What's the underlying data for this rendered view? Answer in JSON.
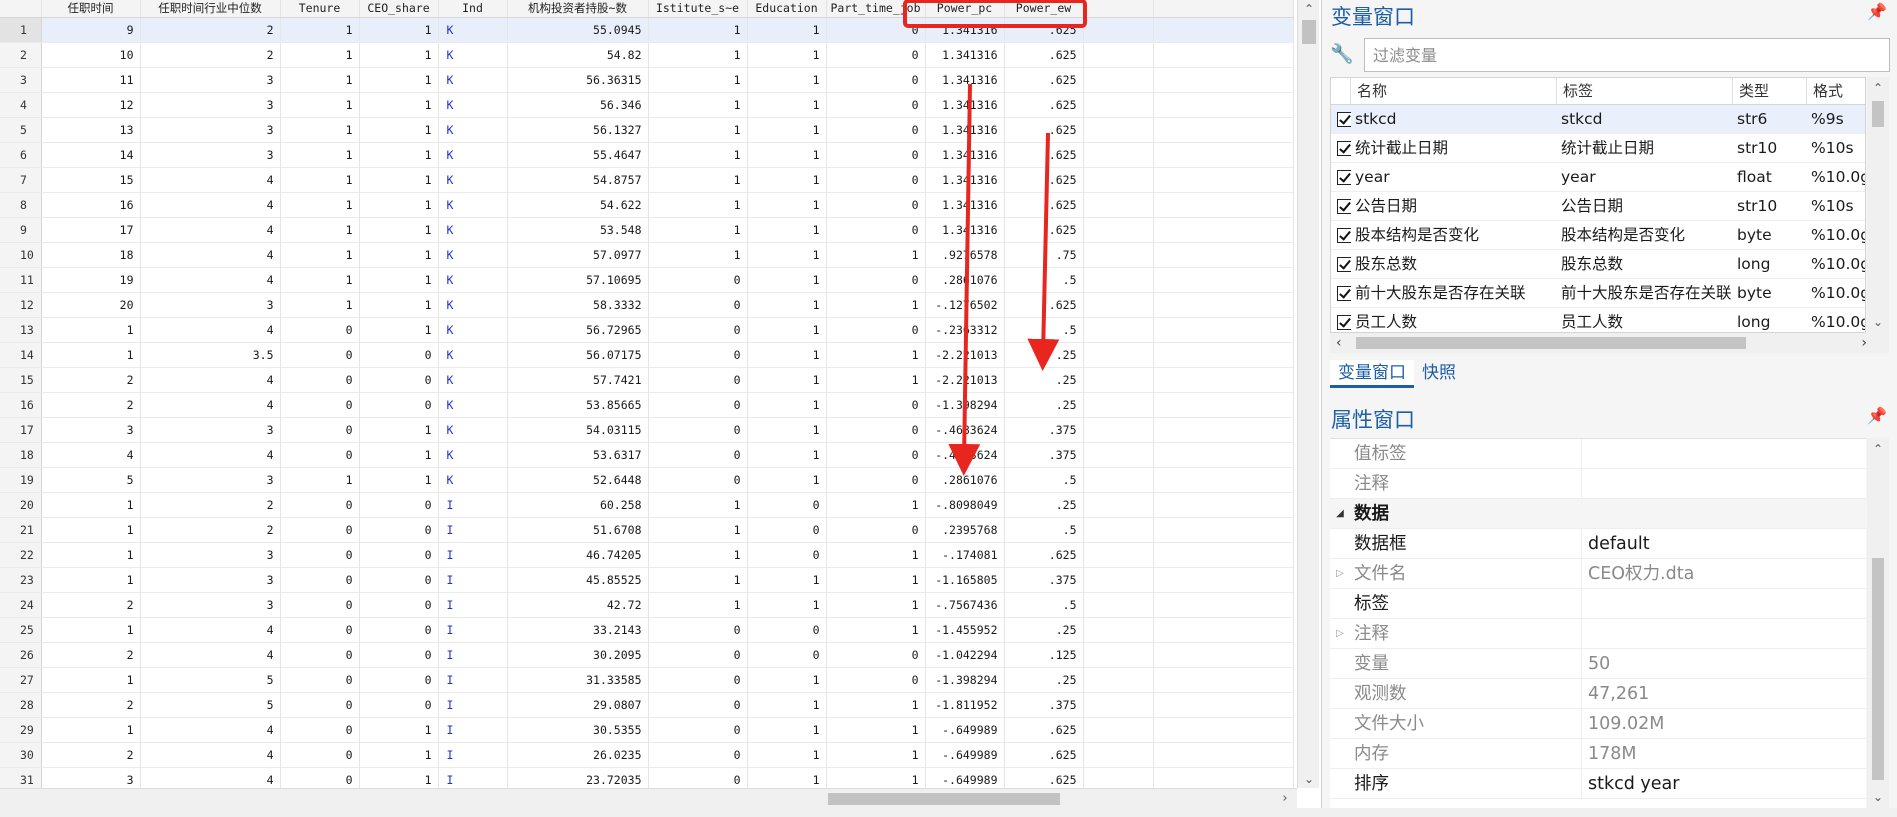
{
  "grid": {
    "columns": [
      "任职时间",
      "任职时间行业中位数",
      "Tenure",
      "CEO_share",
      "Ind",
      "机构投资者持股~数",
      "Istitute_s~e",
      "Education",
      "Part_time_job",
      "Power_pc",
      "Power_ew"
    ],
    "rows": [
      [
        "1",
        "9",
        "2",
        "1",
        "1",
        "K",
        "55.0945",
        "1",
        "1",
        "0",
        "1.341316",
        ".625"
      ],
      [
        "2",
        "10",
        "2",
        "1",
        "1",
        "K",
        "54.82",
        "1",
        "1",
        "0",
        "1.341316",
        ".625"
      ],
      [
        "3",
        "11",
        "3",
        "1",
        "1",
        "K",
        "56.36315",
        "1",
        "1",
        "0",
        "1.341316",
        ".625"
      ],
      [
        "4",
        "12",
        "3",
        "1",
        "1",
        "K",
        "56.346",
        "1",
        "1",
        "0",
        "1.341316",
        ".625"
      ],
      [
        "5",
        "13",
        "3",
        "1",
        "1",
        "K",
        "56.1327",
        "1",
        "1",
        "0",
        "1.341316",
        ".625"
      ],
      [
        "6",
        "14",
        "3",
        "1",
        "1",
        "K",
        "55.4647",
        "1",
        "1",
        "0",
        "1.341316",
        ".625"
      ],
      [
        "7",
        "15",
        "4",
        "1",
        "1",
        "K",
        "54.8757",
        "1",
        "1",
        "0",
        "1.341316",
        ".625"
      ],
      [
        "8",
        "16",
        "4",
        "1",
        "1",
        "K",
        "54.622",
        "1",
        "1",
        "0",
        "1.341316",
        ".625"
      ],
      [
        "9",
        "17",
        "4",
        "1",
        "1",
        "K",
        "53.548",
        "1",
        "1",
        "0",
        "1.341316",
        ".625"
      ],
      [
        "10",
        "18",
        "4",
        "1",
        "1",
        "K",
        "57.0977",
        "1",
        "1",
        "1",
        ".9276578",
        ".75"
      ],
      [
        "11",
        "19",
        "4",
        "1",
        "1",
        "K",
        "57.10695",
        "0",
        "1",
        "0",
        ".2861076",
        ".5"
      ],
      [
        "12",
        "20",
        "3",
        "1",
        "1",
        "K",
        "58.3332",
        "0",
        "1",
        "1",
        "-.1276502",
        ".625"
      ],
      [
        "13",
        "1",
        "4",
        "0",
        "1",
        "K",
        "56.72965",
        "0",
        "1",
        "0",
        "-.2363312",
        ".5"
      ],
      [
        "14",
        "1",
        "3.5",
        "0",
        "0",
        "K",
        "56.07175",
        "0",
        "1",
        "1",
        "-2.221013",
        ".25"
      ],
      [
        "15",
        "2",
        "4",
        "0",
        "0",
        "K",
        "57.7421",
        "0",
        "1",
        "1",
        "-2.221013",
        ".25"
      ],
      [
        "16",
        "2",
        "4",
        "0",
        "0",
        "K",
        "53.85665",
        "0",
        "1",
        "0",
        "-1.398294",
        ".25"
      ],
      [
        "17",
        "3",
        "3",
        "0",
        "1",
        "K",
        "54.03115",
        "0",
        "1",
        "0",
        "-.4683624",
        ".375"
      ],
      [
        "18",
        "4",
        "4",
        "0",
        "1",
        "K",
        "53.6317",
        "0",
        "1",
        "0",
        "-.4683624",
        ".375"
      ],
      [
        "19",
        "5",
        "3",
        "1",
        "1",
        "K",
        "52.6448",
        "0",
        "1",
        "0",
        ".2861076",
        ".5"
      ],
      [
        "20",
        "1",
        "2",
        "0",
        "0",
        "I",
        "60.258",
        "1",
        "0",
        "1",
        "-.8098049",
        ".25"
      ],
      [
        "21",
        "1",
        "2",
        "0",
        "0",
        "I",
        "51.6708",
        "1",
        "0",
        "0",
        ".2395768",
        ".5"
      ],
      [
        "22",
        "1",
        "3",
        "0",
        "0",
        "I",
        "46.74205",
        "1",
        "0",
        "1",
        "-.174081",
        ".625"
      ],
      [
        "23",
        "1",
        "3",
        "0",
        "0",
        "I",
        "45.85525",
        "1",
        "1",
        "1",
        "-1.165805",
        ".375"
      ],
      [
        "24",
        "2",
        "3",
        "0",
        "0",
        "I",
        "42.72",
        "1",
        "1",
        "1",
        "-.7567436",
        ".5"
      ],
      [
        "25",
        "1",
        "4",
        "0",
        "0",
        "I",
        "33.2143",
        "0",
        "0",
        "1",
        "-1.455952",
        ".25"
      ],
      [
        "26",
        "2",
        "4",
        "0",
        "0",
        "I",
        "30.2095",
        "0",
        "0",
        "0",
        "-1.042294",
        ".125"
      ],
      [
        "27",
        "1",
        "5",
        "0",
        "0",
        "I",
        "31.33585",
        "0",
        "1",
        "0",
        "-1.398294",
        ".25"
      ],
      [
        "28",
        "2",
        "5",
        "0",
        "0",
        "I",
        "29.0807",
        "0",
        "1",
        "1",
        "-1.811952",
        ".375"
      ],
      [
        "29",
        "1",
        "4",
        "0",
        "1",
        "I",
        "30.5355",
        "0",
        "1",
        "1",
        "-.649989",
        ".625"
      ],
      [
        "30",
        "2",
        "4",
        "0",
        "1",
        "I",
        "26.0235",
        "0",
        "1",
        "1",
        "-.649989",
        ".625"
      ],
      [
        "31",
        "3",
        "4",
        "0",
        "1",
        "I",
        "23.72035",
        "0",
        "1",
        "1",
        "-.649989",
        ".625"
      ]
    ],
    "annotation_color": "#e8261f"
  },
  "variables_pane": {
    "title": "变量窗口",
    "filter_placeholder": "过滤变量",
    "headers": [
      "名称",
      "标签",
      "类型",
      "格式"
    ],
    "variables": [
      {
        "name": "stkcd",
        "label": "stkcd",
        "type": "str6",
        "format": "%9s"
      },
      {
        "name": "统计截止日期",
        "label": "统计截止日期",
        "type": "str10",
        "format": "%10s"
      },
      {
        "name": "year",
        "label": "year",
        "type": "float",
        "format": "%10.0g"
      },
      {
        "name": "公告日期",
        "label": "公告日期",
        "type": "str10",
        "format": "%10s"
      },
      {
        "name": "股本结构是否变化",
        "label": "股本结构是否变化",
        "type": "byte",
        "format": "%10.0g"
      },
      {
        "name": "股东总数",
        "label": "股东总数",
        "type": "long",
        "format": "%10.0g"
      },
      {
        "name": "前十大股东是否存在关联",
        "label": "前十大股东是否存在关联",
        "type": "byte",
        "format": "%10.0g"
      },
      {
        "name": "员工人数",
        "label": "员工人数",
        "type": "long",
        "format": "%10.0g"
      }
    ],
    "tabs": [
      "变量窗口",
      "快照"
    ]
  },
  "properties_pane": {
    "title": "属性窗口",
    "rows": [
      {
        "key": "值标签",
        "value": "",
        "style": "dim",
        "expander": ""
      },
      {
        "key": "注释",
        "value": "",
        "style": "dim",
        "expander": ""
      },
      {
        "key": "数据",
        "value": "",
        "style": "group",
        "expander": "◢"
      },
      {
        "key": "数据框",
        "value": "default",
        "style": "norm",
        "expander": ""
      },
      {
        "key": "文件名",
        "value": "CEO权力.dta",
        "style": "dim",
        "expander": "▷"
      },
      {
        "key": "标签",
        "value": "",
        "style": "norm",
        "expander": ""
      },
      {
        "key": "注释",
        "value": "",
        "style": "dim",
        "expander": "▷"
      },
      {
        "key": "变量",
        "value": "50",
        "style": "dim",
        "expander": ""
      },
      {
        "key": "观测数",
        "value": "47,261",
        "style": "dim",
        "expander": ""
      },
      {
        "key": "文件大小",
        "value": "109.02M",
        "style": "dim",
        "expander": ""
      },
      {
        "key": "内存",
        "value": "178M",
        "style": "dim",
        "expander": ""
      },
      {
        "key": "排序",
        "value": "stkcd year",
        "style": "norm",
        "expander": ""
      }
    ]
  },
  "icons": {
    "pin": "pin-icon",
    "filter": "wrench-icon"
  }
}
